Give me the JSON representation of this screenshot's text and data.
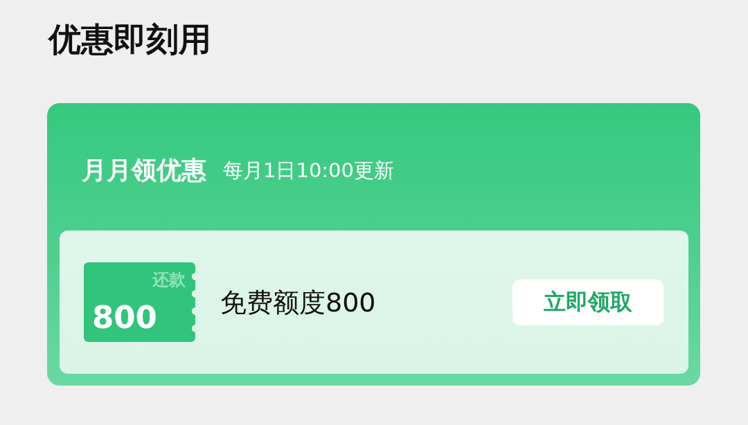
{
  "page_title": "优惠即刻用",
  "promo_card": {
    "title": "月月领优惠",
    "subtitle": "每月1日10:00更新",
    "offers": [
      {
        "coupon": {
          "type_label": "还款",
          "amount": "800"
        },
        "description": "免费额度800",
        "action": "立即领取"
      }
    ]
  }
}
